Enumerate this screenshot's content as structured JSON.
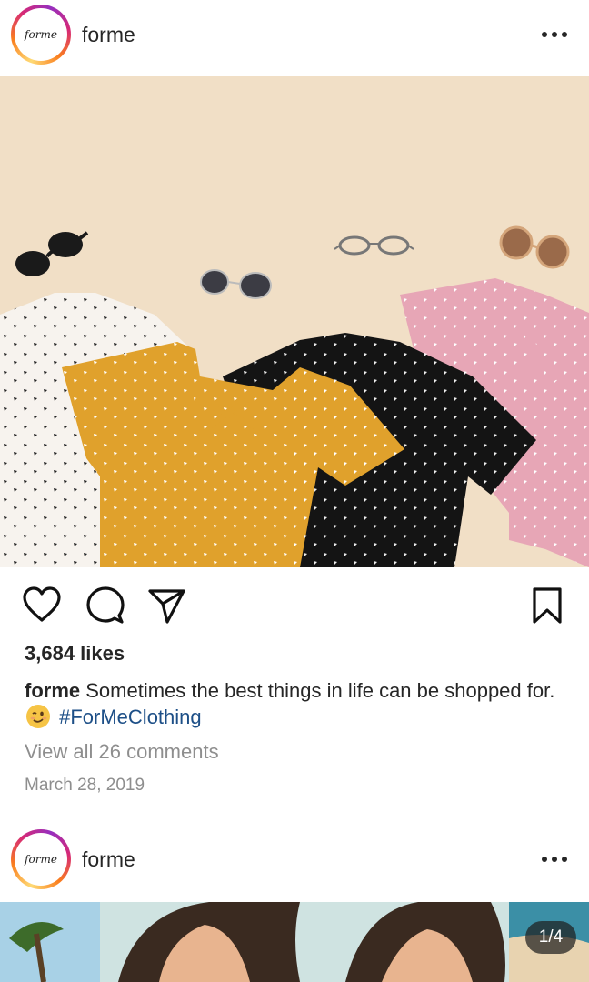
{
  "post1": {
    "avatar_text": "forme",
    "username": "forme",
    "likes": "3,684 likes",
    "caption_user": "forme",
    "caption_text": "Sometimes the best things in life can be shopped for.",
    "caption_emoji": "winking-face",
    "hashtag": "#ForMeClothing",
    "view_comments": "View all 26 comments",
    "date": "March 28, 2019"
  },
  "post2": {
    "avatar_text": "forme",
    "username": "forme",
    "carousel_counter": "1/4"
  },
  "icons": {
    "more": "more-options-icon",
    "like": "heart-icon",
    "comment": "comment-bubble-icon",
    "share": "paper-plane-icon",
    "save": "bookmark-icon"
  },
  "colors": {
    "text": "#262626",
    "muted": "#8e8e8e",
    "hashtag": "#1d4f87",
    "photo_background": "#f1dfc6"
  }
}
